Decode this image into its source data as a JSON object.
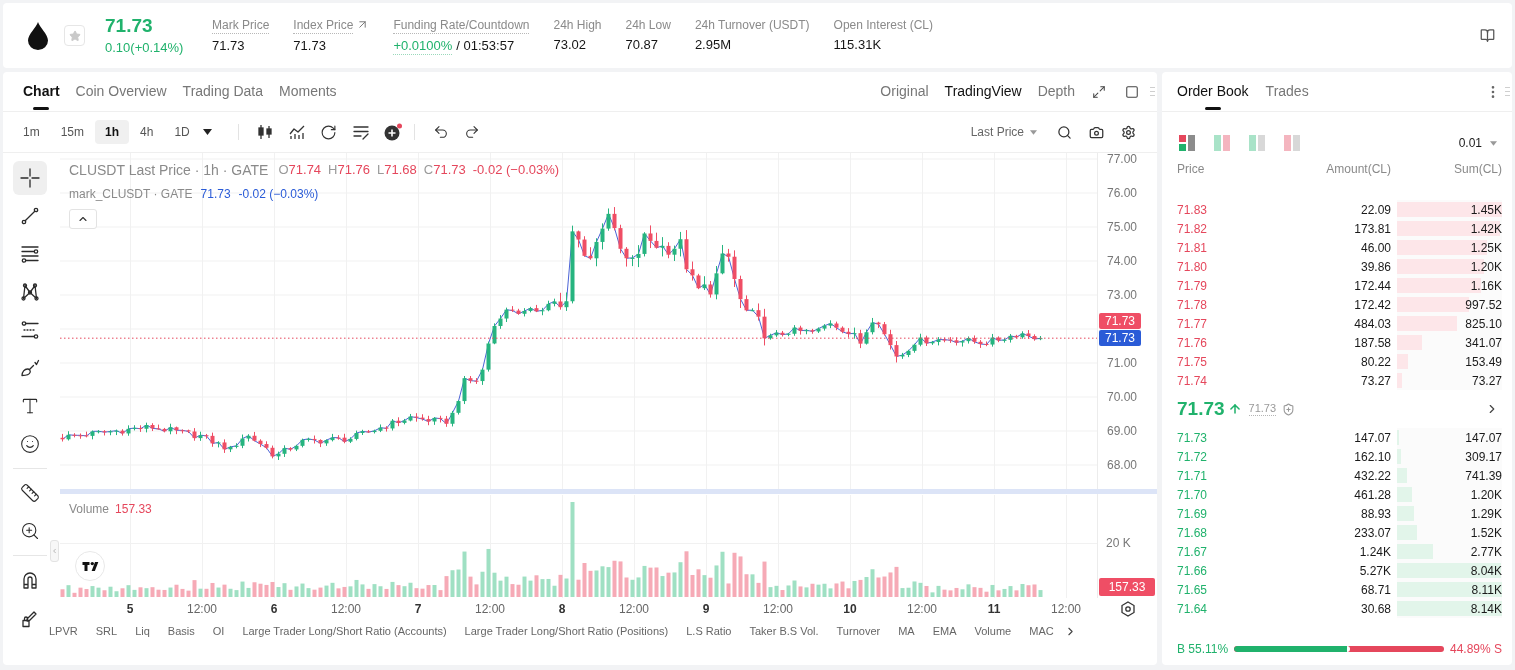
{
  "header": {
    "price": "71.73",
    "change": "0.10(+0.14%)",
    "stats": [
      {
        "kind": "hint",
        "label": "Mark Price",
        "value": "71.73"
      },
      {
        "kind": "link",
        "label": "Index Price",
        "value": "71.73"
      },
      {
        "kind": "funding",
        "label": "Funding Rate/Countdown",
        "value": "+0.0100%",
        "countdown": "/ 01:53:57"
      },
      {
        "kind": "plain",
        "label": "24h High",
        "value": "73.02"
      },
      {
        "kind": "plain",
        "label": "24h Low",
        "value": "70.87"
      },
      {
        "kind": "plain",
        "label": "24h Turnover (USDT)",
        "value": "2.95M"
      },
      {
        "kind": "plain",
        "label": "Open Interest (CL)",
        "value": "115.31K"
      }
    ]
  },
  "chart_panel": {
    "tabs": [
      {
        "label": "Chart",
        "selected": true
      },
      {
        "label": "Coin Overview",
        "selected": false
      },
      {
        "label": "Trading Data",
        "selected": false
      },
      {
        "label": "Moments",
        "selected": false
      }
    ],
    "views": [
      {
        "label": "Original",
        "selected": false
      },
      {
        "label": "TradingView",
        "selected": true
      },
      {
        "label": "Depth",
        "selected": false
      }
    ],
    "intervals": [
      {
        "label": "1m",
        "selected": false
      },
      {
        "label": "15m",
        "selected": false
      },
      {
        "label": "1h",
        "selected": true
      },
      {
        "label": "4h",
        "selected": false
      },
      {
        "label": "1D",
        "selected": false
      }
    ],
    "price_source": "Last Price",
    "tool_groups": [
      [
        {
          "kind": "crosshair",
          "selected": true
        },
        {
          "kind": "trend_line",
          "selected": false
        },
        {
          "kind": "horizontal_lines",
          "selected": false
        },
        {
          "kind": "pattern",
          "selected": false
        },
        {
          "kind": "fib_channel",
          "selected": false
        },
        {
          "kind": "brush",
          "selected": false
        },
        {
          "kind": "text",
          "selected": false
        },
        {
          "kind": "emoji",
          "selected": false
        }
      ],
      [
        {
          "kind": "ruler",
          "selected": false
        },
        {
          "kind": "zoom",
          "selected": false
        }
      ],
      [
        {
          "kind": "magnet",
          "selected": false
        },
        {
          "kind": "pencil_lock",
          "selected": false
        }
      ]
    ],
    "legend": {
      "title": "CLUSDT Last Price · 1h · GATE",
      "ohlc": [
        {
          "key": "O",
          "value": "71.74"
        },
        {
          "key": "H",
          "value": "71.76"
        },
        {
          "key": "L",
          "value": "71.68"
        },
        {
          "key": "C",
          "value": "71.73"
        }
      ],
      "change": "-0.02 (−0.03%)",
      "mark_title": "mark_CLUSDT · GATE",
      "mark_value": "71.73",
      "mark_change": "-0.02 (−0.03%)"
    },
    "price_axis_upper": [
      "77.00",
      "76.00",
      "75.00",
      "74.00",
      "73.00"
    ],
    "last_price_tag": "71.73",
    "mark_price_tag": "71.73",
    "price_axis_lower": [
      "71.00",
      "70.00",
      "69.00",
      "68.00"
    ],
    "volume": {
      "label": "Volume",
      "value": "157.33",
      "axis_label": "20 K",
      "tag": "157.33"
    },
    "time_axis": [
      {
        "label": "5",
        "kind": "day"
      },
      {
        "label": "12:00",
        "kind": "time"
      },
      {
        "label": "6",
        "kind": "day"
      },
      {
        "label": "12:00",
        "kind": "time"
      },
      {
        "label": "7",
        "kind": "day"
      },
      {
        "label": "12:00",
        "kind": "time"
      },
      {
        "label": "8",
        "kind": "day"
      },
      {
        "label": "12:00",
        "kind": "time"
      },
      {
        "label": "9",
        "kind": "day"
      },
      {
        "label": "12:00",
        "kind": "time"
      },
      {
        "label": "10",
        "kind": "day"
      },
      {
        "label": "12:00",
        "kind": "time"
      },
      {
        "label": "11",
        "kind": "day"
      },
      {
        "label": "12:00",
        "kind": "time"
      }
    ],
    "indicators": [
      "LPVR",
      "SRL",
      "Liq",
      "Basis",
      "OI",
      "Large Trader Long/Short Ratio (Accounts)",
      "Large Trader Long/Short Ratio (Positions)",
      "L.S Ratio",
      "Taker B.S Vol.",
      "Turnover",
      "MA",
      "EMA",
      "Volume",
      "MAC"
    ]
  },
  "order_book": {
    "tabs": [
      {
        "label": "Order Book",
        "selected": true
      },
      {
        "label": "Trades",
        "selected": false
      }
    ],
    "views": [
      {
        "kind": "all",
        "selected": true
      },
      {
        "kind": "pair",
        "selected": false
      },
      {
        "kind": "bids",
        "selected": false
      },
      {
        "kind": "asks",
        "selected": false
      }
    ],
    "precision": "0.01",
    "columns": [
      "Price",
      "Amount(CL)",
      "Sum(CL)"
    ],
    "asks": [
      {
        "price": "71.83",
        "amount": "22.09",
        "sum": "1.45K",
        "level": 1.0
      },
      {
        "price": "71.82",
        "amount": "173.81",
        "sum": "1.42K",
        "level": 0.98
      },
      {
        "price": "71.81",
        "amount": "46.00",
        "sum": "1.25K",
        "level": 0.86
      },
      {
        "price": "71.80",
        "amount": "39.86",
        "sum": "1.20K",
        "level": 0.83
      },
      {
        "price": "71.79",
        "amount": "172.44",
        "sum": "1.16K",
        "level": 0.8
      },
      {
        "price": "71.78",
        "amount": "172.42",
        "sum": "997.52",
        "level": 0.69
      },
      {
        "price": "71.77",
        "amount": "484.03",
        "sum": "825.10",
        "level": 0.57
      },
      {
        "price": "71.76",
        "amount": "187.58",
        "sum": "341.07",
        "level": 0.235
      },
      {
        "price": "71.75",
        "amount": "80.22",
        "sum": "153.49",
        "level": 0.106
      },
      {
        "price": "71.74",
        "amount": "73.27",
        "sum": "73.27",
        "level": 0.05
      }
    ],
    "last_price": "71.73",
    "last_price_rising": true,
    "mark_price": "71.73",
    "bids": [
      {
        "price": "71.73",
        "amount": "147.07",
        "sum": "147.07",
        "level": 0.018
      },
      {
        "price": "71.72",
        "amount": "162.10",
        "sum": "309.17",
        "level": 0.038
      },
      {
        "price": "71.71",
        "amount": "432.22",
        "sum": "741.39",
        "level": 0.091
      },
      {
        "price": "71.70",
        "amount": "461.28",
        "sum": "1.20K",
        "level": 0.147
      },
      {
        "price": "71.69",
        "amount": "88.93",
        "sum": "1.29K",
        "level": 0.158
      },
      {
        "price": "71.68",
        "amount": "233.07",
        "sum": "1.52K",
        "level": 0.187
      },
      {
        "price": "71.67",
        "amount": "1.24K",
        "sum": "2.77K",
        "level": 0.34
      },
      {
        "price": "71.66",
        "amount": "5.27K",
        "sum": "8.04K",
        "level": 0.988
      },
      {
        "price": "71.65",
        "amount": "68.71",
        "sum": "8.11K",
        "level": 0.996
      },
      {
        "price": "71.64",
        "amount": "30.68",
        "sum": "8.14K",
        "level": 1.0
      }
    ],
    "ratio": {
      "buy": "B 55.11%",
      "sell": "44.89% S",
      "level": 0.5511
    }
  }
}
